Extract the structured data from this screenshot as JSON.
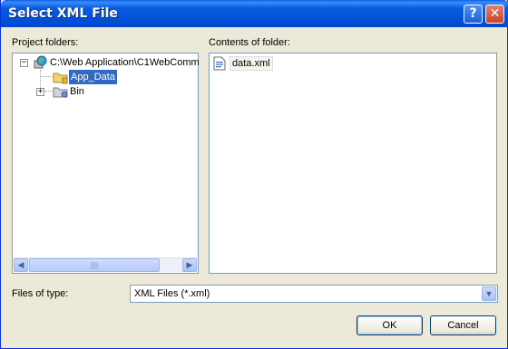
{
  "window": {
    "title": "Select XML File",
    "help_glyph": "?",
    "close_glyph": "✕"
  },
  "project_folders": {
    "label": "Project folders:",
    "tree": [
      {
        "label": "C:\\Web Application\\C1WebComm",
        "icon": "web-project-icon",
        "expander": "−"
      },
      {
        "label": "App_Data",
        "icon": "folder-icon",
        "selected": true
      },
      {
        "label": "Bin",
        "icon": "folder-gear-icon",
        "expander": "+"
      }
    ]
  },
  "contents": {
    "label": "Contents of folder:",
    "files": [
      {
        "label": "data.xml",
        "icon": "xml-file-icon"
      }
    ]
  },
  "scrollbar": {
    "left_arrow": "◀",
    "right_arrow": "▶",
    "grip": "||||"
  },
  "file_type": {
    "label": "Files of type:",
    "value": "XML Files (*.xml)",
    "arrow": "▼"
  },
  "buttons": {
    "ok": "OK",
    "cancel": "Cancel"
  },
  "colors": {
    "titlebar": "#0350d9",
    "selection": "#316ac5",
    "panel_border": "#7f9db9",
    "dialog_bg": "#ece9d8"
  }
}
